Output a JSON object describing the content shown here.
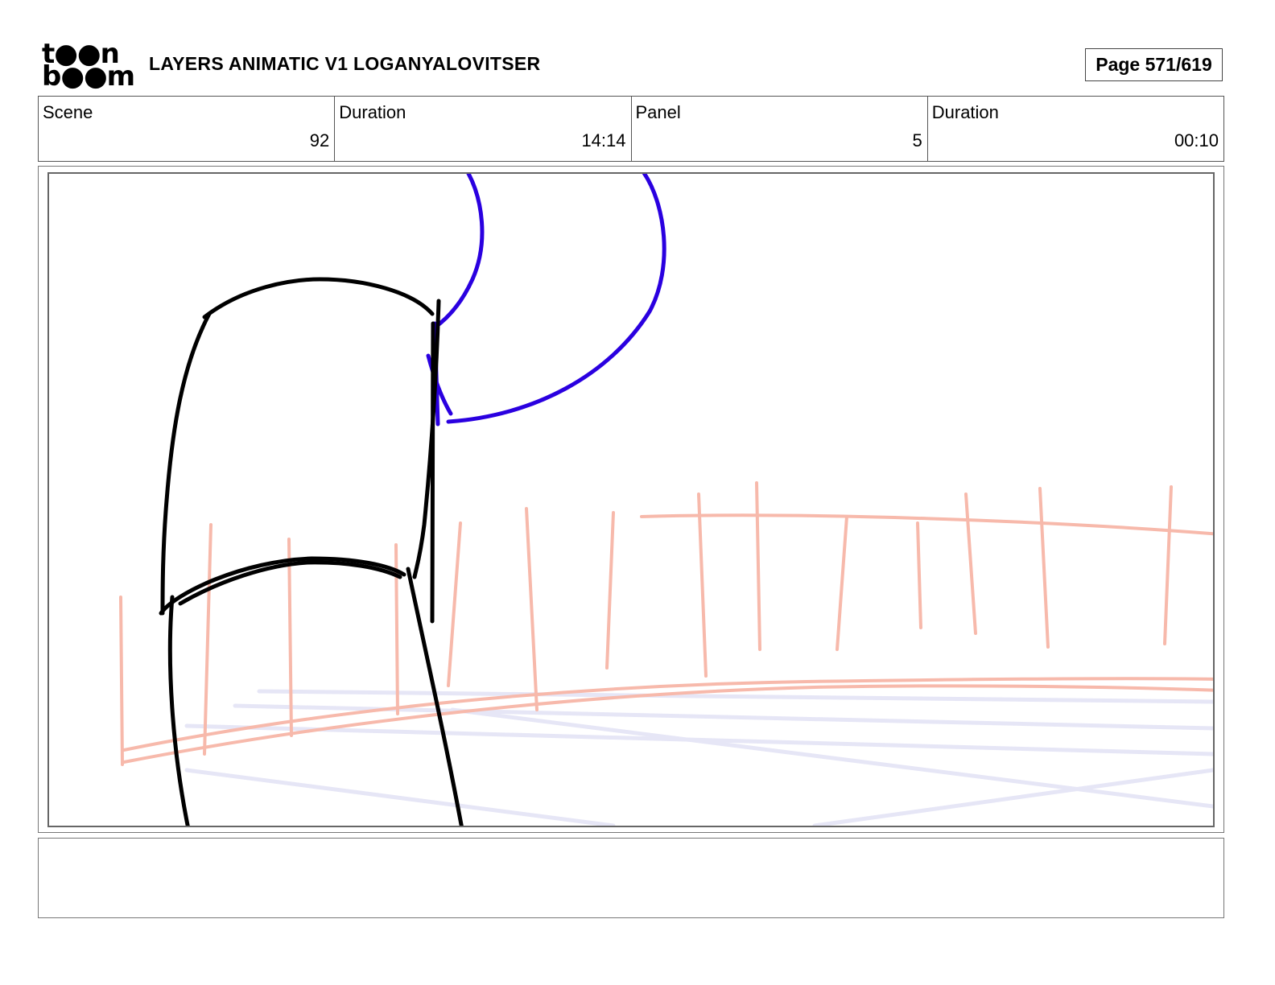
{
  "header": {
    "logo_line1": "t●●n",
    "logo_line2": "b●●m",
    "title": "LAYERS ANIMATIC V1 LOGANYALOVITSER",
    "page": "Page 571/619"
  },
  "info": {
    "scene_label": "Scene",
    "scene_value": "92",
    "scene_duration_label": "Duration",
    "scene_duration_value": "14:14",
    "panel_label": "Panel",
    "panel_value": "5",
    "panel_duration_label": "Duration",
    "panel_duration_value": "00:10"
  },
  "panel": {
    "colors": {
      "character_lines": "#000000",
      "blue_lines": "#2a00e0",
      "fence_lines": "#f7b9ab",
      "ground_lines": "#e6e6f6"
    }
  },
  "notes": {
    "text": ""
  }
}
